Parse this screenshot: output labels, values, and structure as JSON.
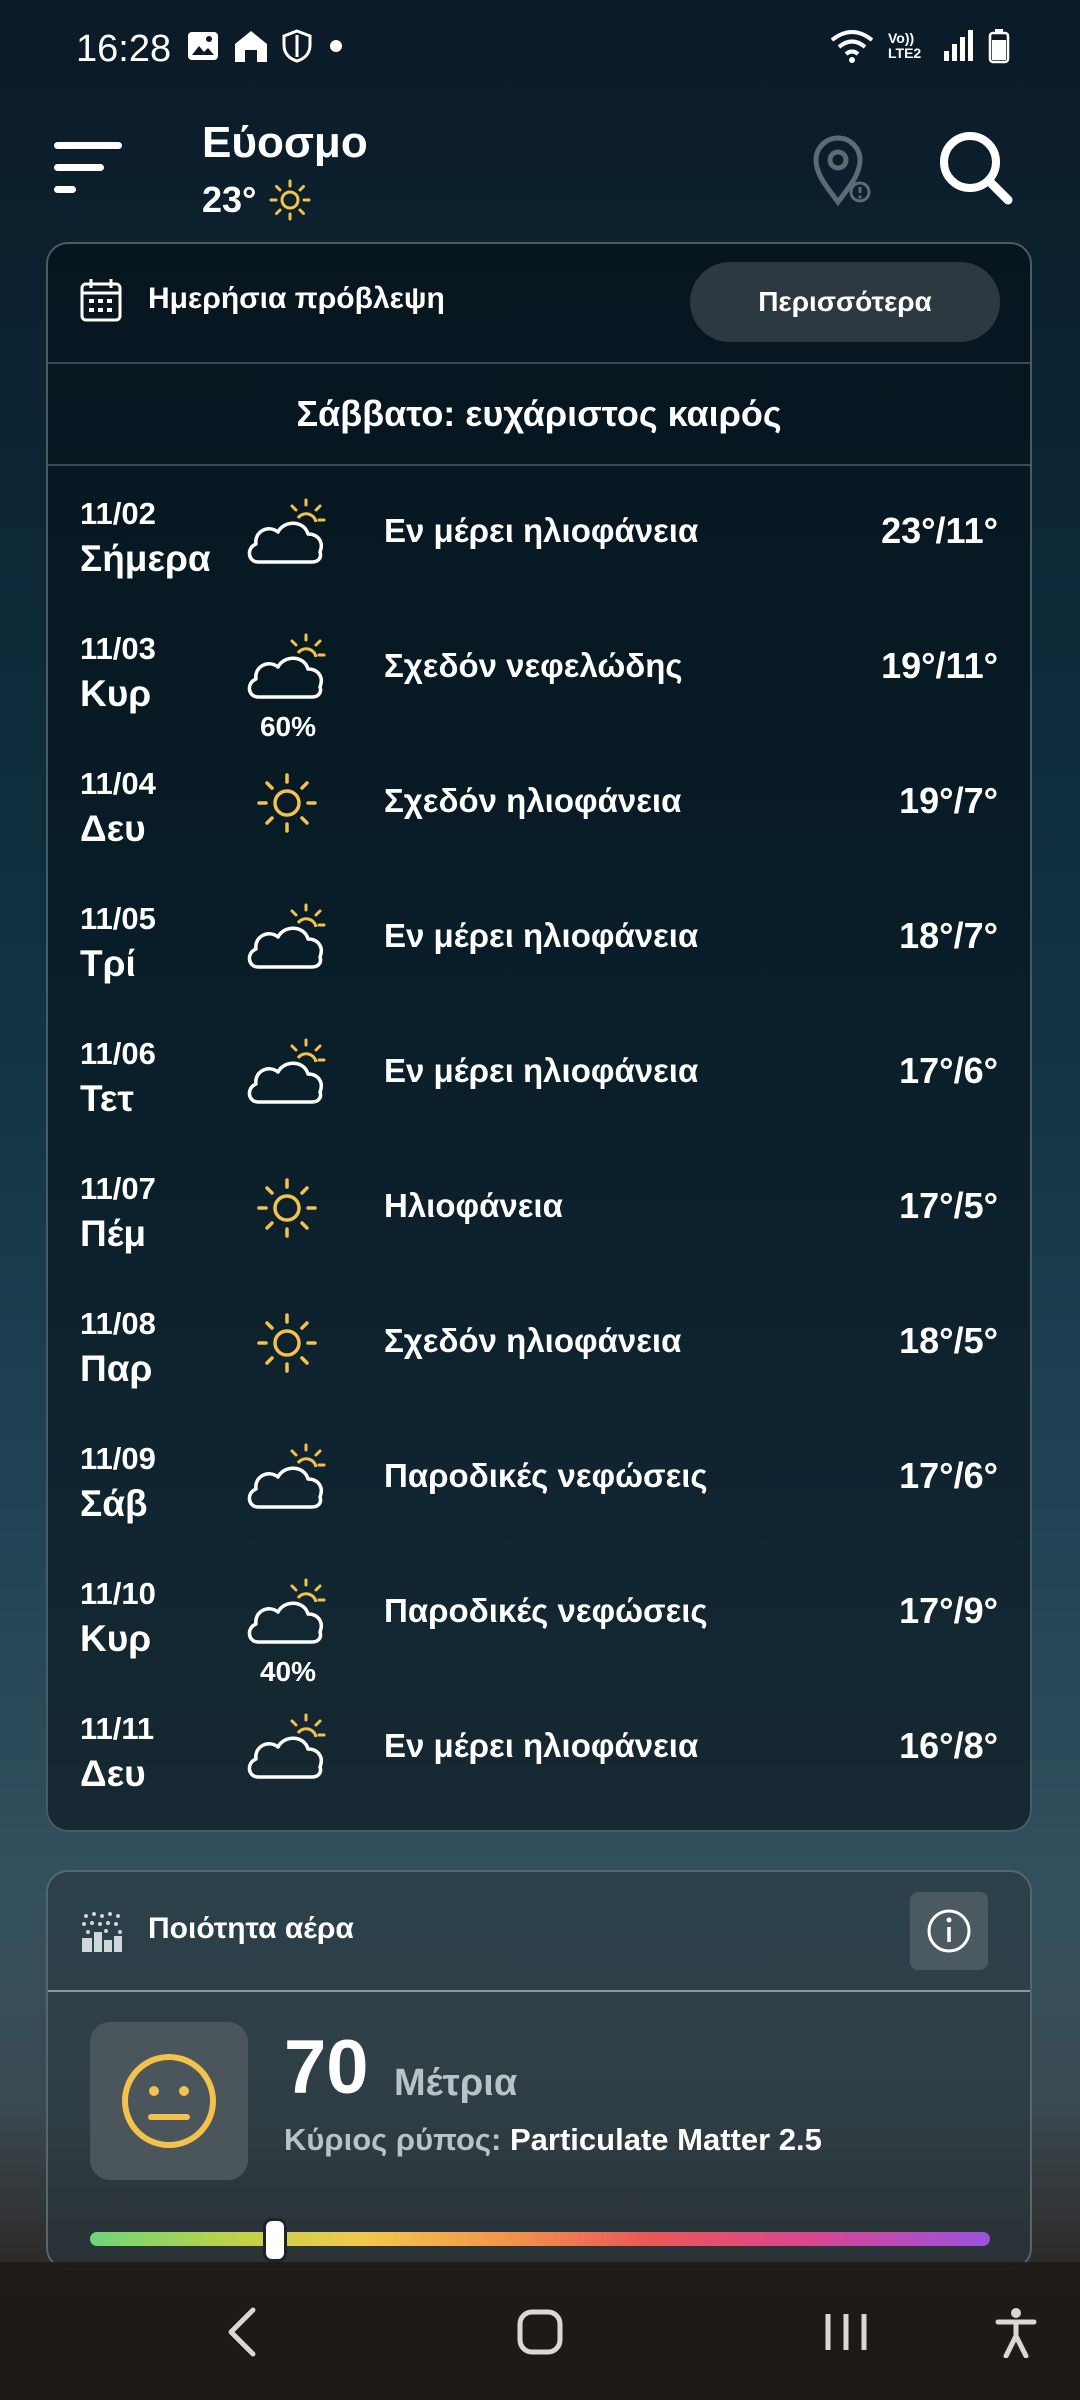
{
  "status_bar": {
    "time": "16:28",
    "left_icons": [
      "image-icon",
      "home-icon",
      "shield-icon",
      "dot-icon"
    ],
    "right_icons": [
      "wifi-icon",
      "volte-icon",
      "signal-icon",
      "battery-icon"
    ],
    "volte_text": "Vo)) LTE2"
  },
  "header": {
    "city": "Εύοσμο",
    "current_temp": "23°",
    "current_icon": "sun-icon"
  },
  "daily": {
    "title": "Ημερήσια πρόβλεψη",
    "more_label": "Περισσότερα",
    "summary": "Σάββατο: ευχάριστος καιρός",
    "rows": [
      {
        "date": "11/02",
        "day": "Σήμερα",
        "icon": "partly-cloudy",
        "precip": "",
        "cond": "Εν μέρει ηλιοφάνεια",
        "temps": "23°/11°"
      },
      {
        "date": "11/03",
        "day": "Κυρ",
        "icon": "partly-cloudy",
        "precip": "60%",
        "cond": "Σχεδόν νεφελώδης",
        "temps": "19°/11°"
      },
      {
        "date": "11/04",
        "day": "Δευ",
        "icon": "sunny",
        "precip": "",
        "cond": "Σχεδόν ηλιοφάνεια",
        "temps": "19°/7°"
      },
      {
        "date": "11/05",
        "day": "Τρί",
        "icon": "partly-cloudy",
        "precip": "",
        "cond": "Εν μέρει ηλιοφάνεια",
        "temps": "18°/7°"
      },
      {
        "date": "11/06",
        "day": "Τετ",
        "icon": "partly-cloudy",
        "precip": "",
        "cond": "Εν μέρει ηλιοφάνεια",
        "temps": "17°/6°"
      },
      {
        "date": "11/07",
        "day": "Πέμ",
        "icon": "sunny",
        "precip": "",
        "cond": "Ηλιοφάνεια",
        "temps": "17°/5°"
      },
      {
        "date": "11/08",
        "day": "Παρ",
        "icon": "sunny",
        "precip": "",
        "cond": "Σχεδόν ηλιοφάνεια",
        "temps": "18°/5°"
      },
      {
        "date": "11/09",
        "day": "Σάβ",
        "icon": "partly-cloudy",
        "precip": "",
        "cond": "Παροδικές νεφώσεις",
        "temps": "17°/6°"
      },
      {
        "date": "11/10",
        "day": "Κυρ",
        "icon": "partly-cloudy",
        "precip": "40%",
        "cond": "Παροδικές νεφώσεις",
        "temps": "17°/9°"
      },
      {
        "date": "11/11",
        "day": "Δευ",
        "icon": "partly-cloudy",
        "precip": "",
        "cond": "Εν μέρει ηλιοφάνεια",
        "temps": "16°/8°"
      }
    ]
  },
  "air_quality": {
    "title": "Ποιότητα αέρα",
    "aqi": "70",
    "level": "Μέτρια",
    "pollutant_label": "Κύριος ρύπος:",
    "pollutant_value": "Particulate Matter 2.5",
    "scale_position": 0.205,
    "face_icon": "neutral-face-icon"
  },
  "colors": {
    "sun": "#f2c24c",
    "card_border": "#4a5b66"
  },
  "nav": [
    "back-icon",
    "home-icon",
    "recents-icon",
    "accessibility-icon"
  ]
}
